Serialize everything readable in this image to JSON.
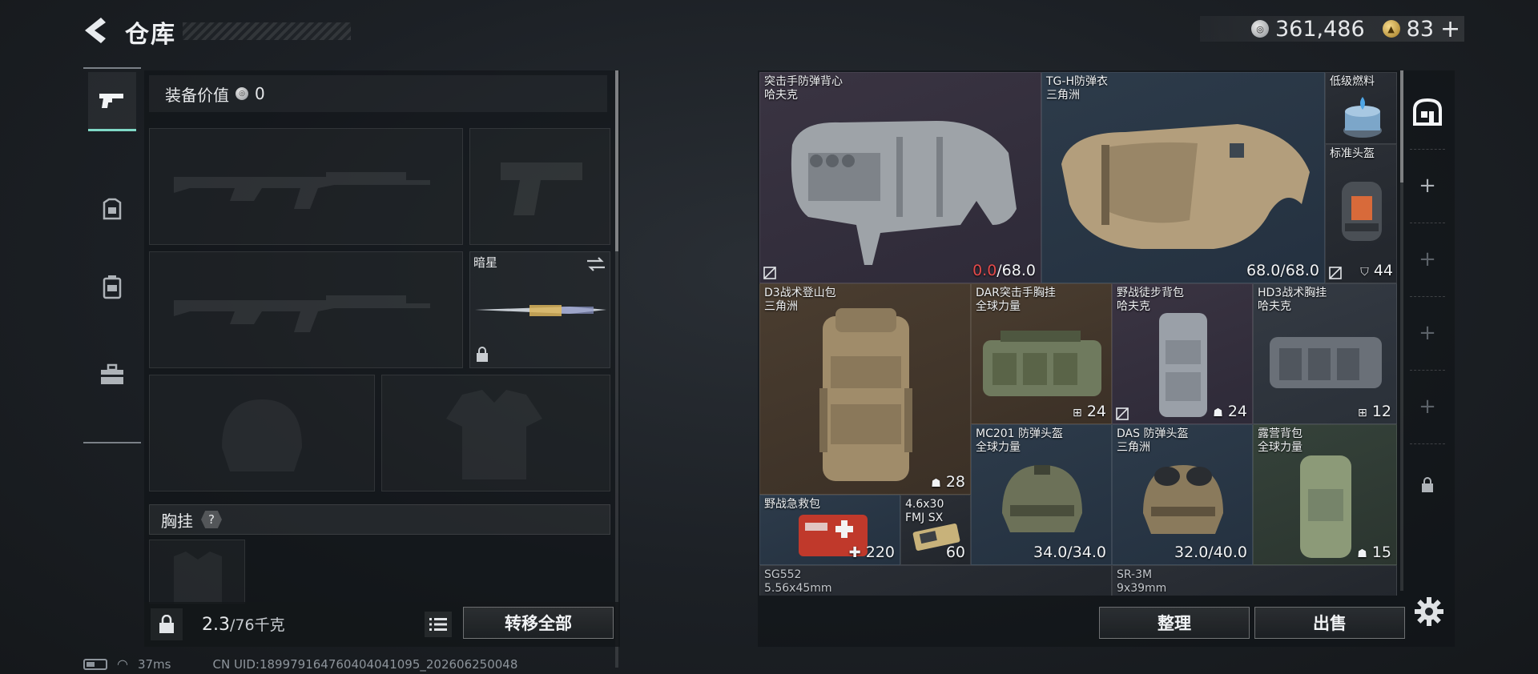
{
  "header": {
    "title": "仓库",
    "currency_silver": "361,486",
    "currency_gold": "83",
    "gold_plus": "+"
  },
  "left_panel": {
    "equipment_value_label": "装备价值",
    "equipment_value": "0",
    "melee_slot": {
      "name": "暗星"
    },
    "section_title": "胸挂",
    "section_help": "?",
    "weight_current": "2.3",
    "weight_max": "/76千克",
    "transfer_all_label": "转移全部"
  },
  "items": [
    {
      "name": "突击手防弹背心",
      "sub": "哈夫克",
      "dur_current": "0.0",
      "dur_max": "/68.0",
      "rarity": "purple",
      "icon": "vest-icon"
    },
    {
      "name": "TG-H防弹衣",
      "sub": "三角洲",
      "dur_value": "68.0/68.0",
      "rarity": "blue",
      "icon": "body-armor-icon"
    },
    {
      "name": "低级燃料",
      "sub": "",
      "rarity": "dark",
      "icon": "fuel-icon"
    },
    {
      "name": "标准头盔",
      "sub": "",
      "badge": "44",
      "rarity": "dark",
      "icon": "helmet-icon"
    },
    {
      "name": "D3战术登山包",
      "sub": "三角洲",
      "badge": "28",
      "rarity": "brown",
      "icon": "backpack-icon"
    },
    {
      "name": "DAR突击手胸挂",
      "sub": "全球力量",
      "badge": "24",
      "rarity": "brown",
      "icon": "chest-rig-icon"
    },
    {
      "name": "野战徒步背包",
      "sub": "哈夫克",
      "badge": "24",
      "rarity": "purple",
      "icon": "backpack-icon"
    },
    {
      "name": "HD3战术胸挂",
      "sub": "哈夫克",
      "badge": "12",
      "rarity": "slate",
      "icon": "chest-rig-icon"
    },
    {
      "name": "MC201 防弹头盔",
      "sub": "全球力量",
      "dur_value": "34.0/34.0",
      "rarity": "blue",
      "icon": "helmet-icon"
    },
    {
      "name": "DAS 防弹头盔",
      "sub": "三角洲",
      "dur_value": "32.0/40.0",
      "rarity": "blue",
      "icon": "helmet-icon"
    },
    {
      "name": "露营背包",
      "sub": "全球力量",
      "badge": "15",
      "rarity": "green",
      "icon": "backpack-icon"
    },
    {
      "name": "野战急救包",
      "sub": "",
      "badge": "220",
      "rarity": "blue",
      "icon": "medkit-icon"
    },
    {
      "name": "4.6x30",
      "sub": "FMJ SX",
      "badge": "60",
      "rarity": "dark",
      "icon": "ammo-icon"
    },
    {
      "name": "SG552",
      "sub": "5.56x45mm",
      "rarity": "dark",
      "icon": "rifle-icon"
    },
    {
      "name": "SR-3M",
      "sub": "9x39mm",
      "rarity": "dark",
      "icon": "rifle-icon"
    }
  ],
  "right_panel": {
    "sort_label": "整理",
    "sell_label": "出售"
  },
  "status": {
    "ping": "37ms",
    "uid": "CN UID:18997916476040404​1095_202606250048"
  },
  "colors": {
    "accent": "#7fd8c6",
    "durability_low": "#e34a4a",
    "rarity_purple": "#3a3442",
    "rarity_blue": "#2d3b4a",
    "rarity_brown": "#4a3d30",
    "rarity_green": "#35423a"
  }
}
